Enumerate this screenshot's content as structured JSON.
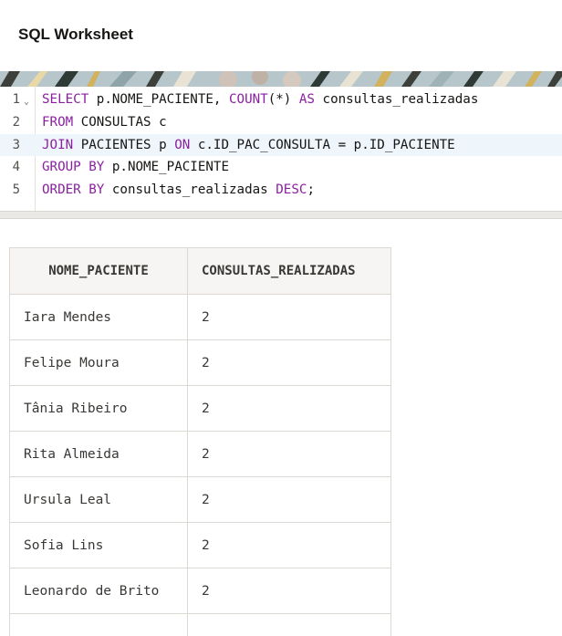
{
  "header": {
    "title": "SQL Worksheet"
  },
  "editor": {
    "lines": [
      {
        "num": "1",
        "tokens": [
          {
            "t": "SELECT",
            "kw": true
          },
          {
            "t": " p.NOME_PACIENTE, "
          },
          {
            "t": "COUNT",
            "kw": true
          },
          {
            "t": "(*) "
          },
          {
            "t": "AS",
            "kw": true
          },
          {
            "t": " consultas_realizadas"
          }
        ]
      },
      {
        "num": "2",
        "tokens": [
          {
            "t": "FROM",
            "kw": true
          },
          {
            "t": " CONSULTAS c"
          }
        ]
      },
      {
        "num": "3",
        "tokens": [
          {
            "t": "JOIN",
            "kw": true
          },
          {
            "t": " PACIENTES p "
          },
          {
            "t": "ON",
            "kw": true
          },
          {
            "t": " c.ID_PAC_CONSULTA = p.ID_PACIENTE"
          }
        ]
      },
      {
        "num": "4",
        "tokens": [
          {
            "t": "GROUP BY",
            "kw": true
          },
          {
            "t": " p.NOME_PACIENTE"
          }
        ]
      },
      {
        "num": "5",
        "tokens": [
          {
            "t": "ORDER BY",
            "kw": true
          },
          {
            "t": " consultas_realizadas "
          },
          {
            "t": "DESC",
            "kw": true
          },
          {
            "t": ";"
          }
        ]
      }
    ],
    "active_line": "3",
    "fold_icon": "chevron-down-icon"
  },
  "results": {
    "columns": [
      "NOME_PACIENTE",
      "CONSULTAS_REALIZADAS"
    ],
    "rows": [
      [
        "Iara Mendes",
        "2"
      ],
      [
        "Felipe Moura",
        "2"
      ],
      [
        "Tânia Ribeiro",
        "2"
      ],
      [
        "Rita Almeida",
        "2"
      ],
      [
        "Ursula Leal",
        "2"
      ],
      [
        "Sofia Lins",
        "2"
      ],
      [
        "Leonardo de Brito",
        "2"
      ]
    ]
  },
  "colors": {
    "keyword": "#8a1fa0",
    "active_line": "#eef5fb"
  }
}
